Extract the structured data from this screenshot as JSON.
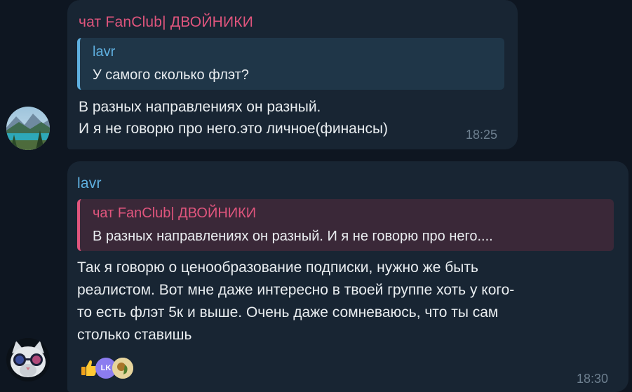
{
  "messages": [
    {
      "sender": "чат FanClub| ДВОЙНИКИ",
      "reply": {
        "author": "lavr",
        "text": "У самого сколько флэт?"
      },
      "lines": [
        "В разных направлениях он разный.",
        "И я не говорю про него.это личное(финансы)"
      ],
      "time": "18:25"
    },
    {
      "sender": "lavr",
      "reply": {
        "author": "чат FanClub| ДВОЙНИКИ",
        "text": "В разных направлениях он разный.  И я не говорю про него...."
      },
      "lines": [
        "Так я говорю о ценообразование подписки, нужно же быть",
        "реалистом. Вот мне даже интересно в твоей группе хоть у кого-",
        "то есть флэт 5к и выше. Очень даже сомневаюсь, что ты сам",
        "столько ставишь"
      ],
      "reactions": {
        "badge_text": "LK"
      },
      "time": "18:30"
    }
  ],
  "colors": {
    "background": "#0e1621",
    "bubble": "#182533",
    "pink_name": "#e0557d",
    "blue_name": "#5fb0e0",
    "reply_blue_bg": "#1f3648",
    "reply_pink_bg": "#3a2838",
    "time": "#6d7f8f"
  }
}
